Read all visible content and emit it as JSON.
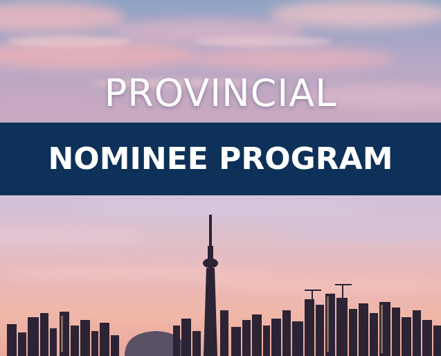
{
  "headline": {
    "line1": "PROVINCIAL",
    "line2": "NOMINEE PROGRAM"
  },
  "colors": {
    "band": "#0d3158",
    "text": "#ffffff"
  },
  "scene": {
    "sky-icon": "sunset-sky-icon",
    "skyline-icon": "city-skyline-icon"
  }
}
